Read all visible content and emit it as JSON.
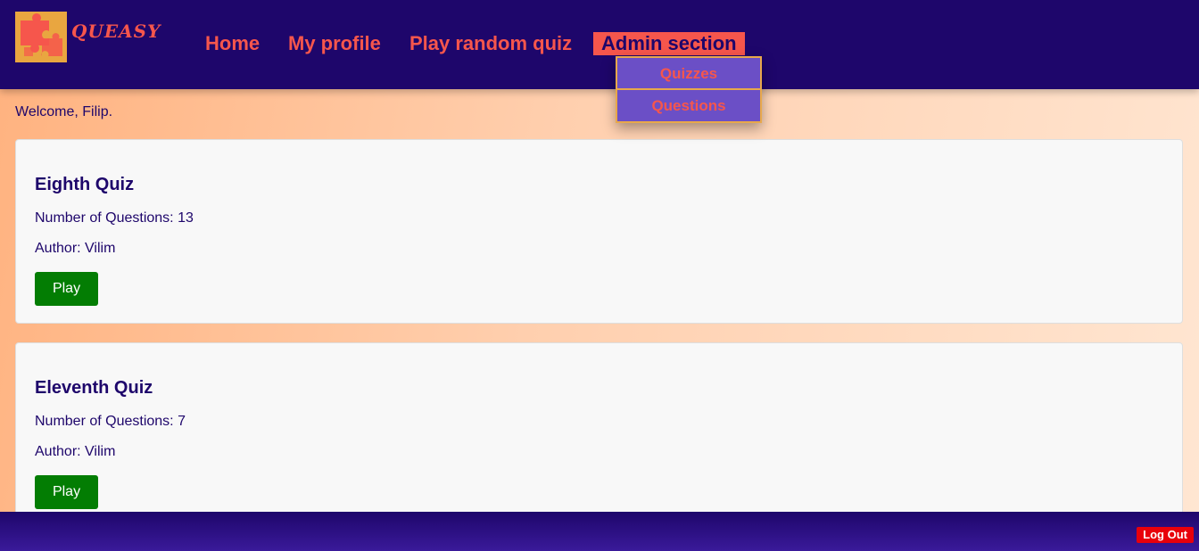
{
  "brand": {
    "name": "QUEASY",
    "accent": "#f6564c",
    "navy": "#1e066b"
  },
  "nav": {
    "home": "Home",
    "profile": "My profile",
    "random": "Play random quiz",
    "admin": "Admin section"
  },
  "admin_menu": {
    "quizzes": "Quizzes",
    "questions": "Questions"
  },
  "welcome": "Welcome, Filip.",
  "quizzes": [
    {
      "title": "Eighth Quiz",
      "questions": "Number of Questions: 13",
      "author": "Author: Vilim",
      "play": "Play"
    },
    {
      "title": "Eleventh Quiz",
      "questions": "Number of Questions: 7",
      "author": "Author: Vilim",
      "play": "Play"
    }
  ],
  "footer": {
    "logout": "Log Out"
  },
  "icons": {
    "logo": "puzzle-logo-icon"
  }
}
